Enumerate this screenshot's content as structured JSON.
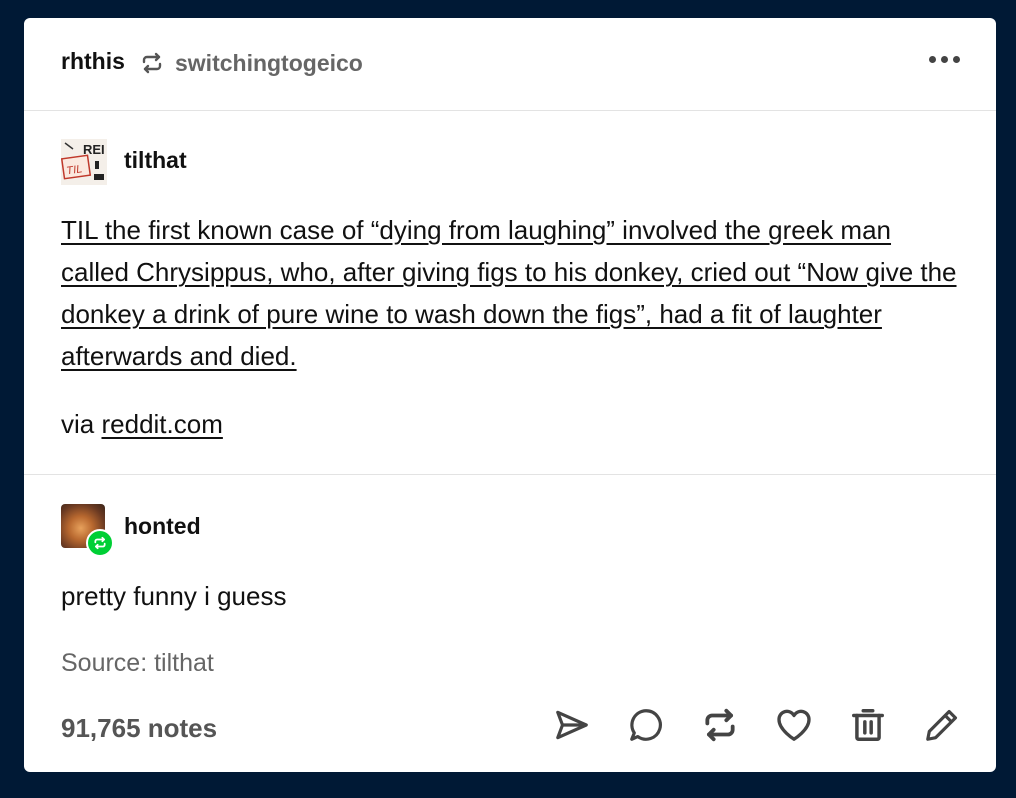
{
  "header": {
    "reblogger": "rhthis",
    "source_blog": "switchingtogeico",
    "reblog_icon": "reblog-icon",
    "menu_icon": "meatball-menu-icon"
  },
  "original_post": {
    "blog_name": "tilthat",
    "avatar_text_top": "REI",
    "avatar_text_badge": "TIL",
    "text": "TIL the first known case of “dying from laughing” involved the greek man called Chrysippus, who, after giving figs to his donkey, cried out “Now give the donkey a drink of pure wine to wash down the figs”, had a fit of laughter afterwards and died.",
    "via_prefix": "via",
    "via_link": "reddit.com"
  },
  "reblog": {
    "blog_name": "honted",
    "comment": "pretty funny i guess",
    "source_line": "Source: tilthat",
    "reblog_badge_color": "#00cf35"
  },
  "footer": {
    "notes": "91,765 notes",
    "actions": [
      "share-icon",
      "reply-icon",
      "reblog-icon",
      "like-icon",
      "delete-icon",
      "edit-icon"
    ]
  },
  "colors": {
    "background": "#001935",
    "card": "#ffffff",
    "secondary_text": "#666666",
    "accent_green": "#00cf35"
  }
}
